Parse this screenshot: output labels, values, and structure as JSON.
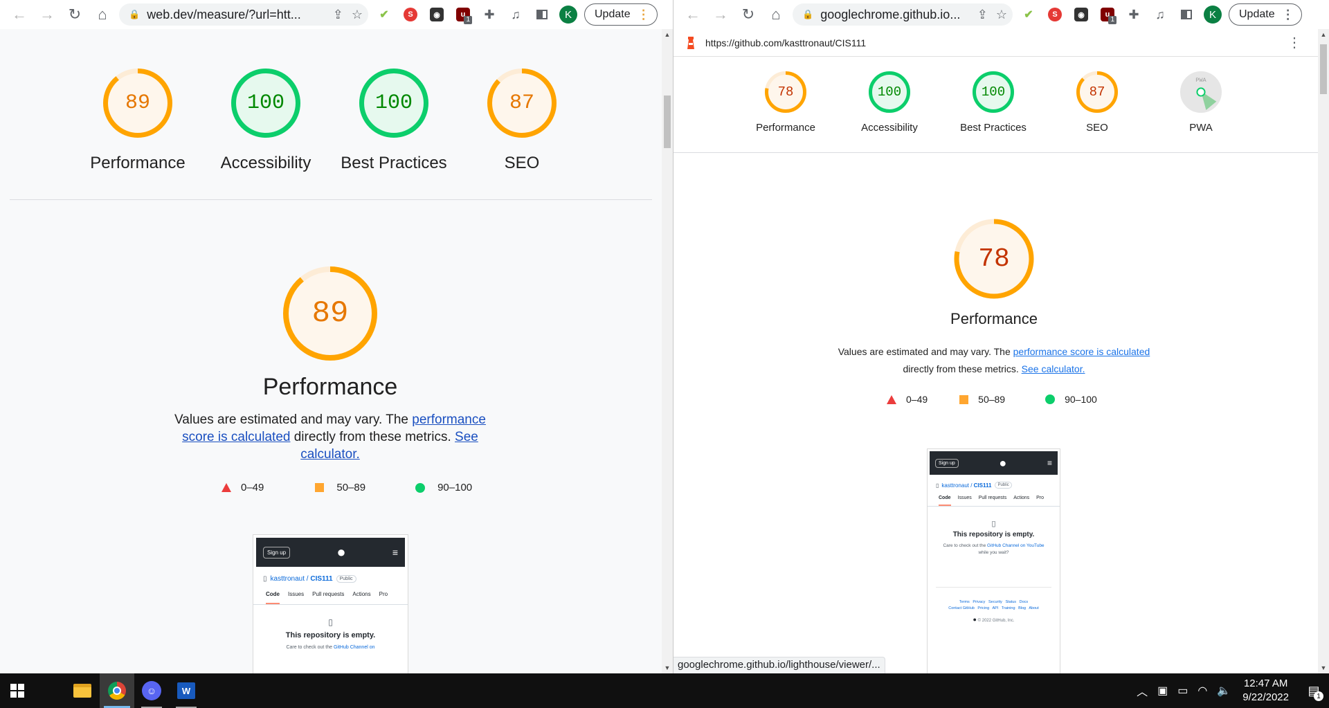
{
  "left": {
    "url": "web.dev/measure/?url=htt...",
    "update_label": "Update",
    "profile_initial": "K",
    "ext_badge": "1",
    "scores": [
      {
        "value": 89,
        "label": "Performance",
        "color": "#ffa400"
      },
      {
        "value": 100,
        "label": "Accessibility",
        "color": "#0cce6b"
      },
      {
        "value": 100,
        "label": "Best Practices",
        "color": "#0cce6b"
      },
      {
        "value": 87,
        "label": "SEO",
        "color": "#ffa400"
      }
    ],
    "main_gauge": {
      "value": 89,
      "label": "Performance",
      "color": "#ffa400"
    },
    "desc": {
      "pre": "Values are estimated and may vary. The ",
      "link1": "performance score is calculated",
      "mid": " directly from these metrics. ",
      "link2": "See calculator."
    },
    "legend": [
      "0–49",
      "50–89",
      "90–100"
    ]
  },
  "right": {
    "url": "googlechrome.github.io...",
    "update_label": "Update",
    "profile_initial": "K",
    "ext_badge": "1",
    "report_url": "https://github.com/kasttronaut/CIS111",
    "scores": [
      {
        "value": 78,
        "label": "Performance",
        "color": "#ffa400"
      },
      {
        "value": 100,
        "label": "Accessibility",
        "color": "#0cce6b"
      },
      {
        "value": 100,
        "label": "Best Practices",
        "color": "#0cce6b"
      },
      {
        "value": 87,
        "label": "SEO",
        "color": "#ffa400"
      },
      {
        "value": null,
        "label": "PWA",
        "color": "#9e9e9e"
      }
    ],
    "main_gauge": {
      "value": 78,
      "label": "Performance",
      "color": "#ffa400"
    },
    "desc": {
      "pre": "Values are estimated and may vary. The ",
      "link1": "performance score is calculated",
      "mid": " directly from these metrics. ",
      "link2": "See calculator."
    },
    "legend": [
      "0–49",
      "50–89",
      "90–100"
    ],
    "status_url": "googlechrome.github.io/lighthouse/viewer/..."
  },
  "screenshot": {
    "signup": "Sign up",
    "owner": "kasttronaut",
    "repo": "CIS111",
    "visibility": "Public",
    "tabs": [
      "Code",
      "Issues",
      "Pull requests",
      "Actions",
      "Pro"
    ],
    "empty": "This repository is empty.",
    "care_pre": "Care to check out the ",
    "care_link": "GitHub Channel on YouTube",
    "care_post": " while you wait?",
    "care_pre_left": "Care to check out the ",
    "care_link_left": "GitHub Channel on",
    "footer1": "Terms   Privacy   Security   Status   Docs",
    "footer2": "Contact GitHub   Pricing   API   Training   Blog   About",
    "copyright": "© 2022 GitHub, Inc."
  },
  "taskbar": {
    "time": "12:47 AM",
    "date": "9/22/2022",
    "notif_count": "1"
  },
  "icons": [
    "back-icon",
    "forward-icon",
    "reload-icon",
    "home-icon",
    "lock-icon",
    "share-icon",
    "star-icon",
    "puzzle-icon",
    "media-icon",
    "sidepanel-icon",
    "kebab-icon",
    "windows-start-icon",
    "file-explorer-icon",
    "chrome-icon",
    "discord-icon",
    "word-icon",
    "chevron-up-icon",
    "meet-icon",
    "battery-icon",
    "wifi-icon",
    "volume-icon",
    "notification-icon",
    "lighthouse-icon"
  ]
}
